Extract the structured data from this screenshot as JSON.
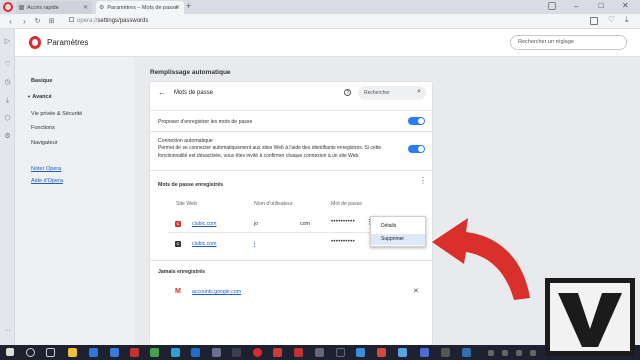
{
  "browser": {
    "tabs": [
      {
        "label": "Accès rapide",
        "active": false
      },
      {
        "label": "Paramètres – Mots de passe",
        "active": true
      }
    ],
    "address": {
      "prefix": "opera://",
      "path": "settings/passwords"
    }
  },
  "header": {
    "title": "Paramètres",
    "search_placeholder": "Rechercher un réglage"
  },
  "nav": {
    "items": [
      {
        "label": "Basique"
      },
      {
        "label": "Avancé"
      },
      {
        "label": "Vie privée & Sécurité"
      },
      {
        "label": "Fonctions"
      },
      {
        "label": "Navigateur"
      }
    ],
    "links": [
      {
        "label": "Noter Opera"
      },
      {
        "label": "Aide d'Opera"
      }
    ]
  },
  "section": {
    "title": "Remplissage automatique"
  },
  "passwords": {
    "title": "Mots de passe",
    "search_placeholder": "Rechercher",
    "offer_save_label": "Proposer d'enregistrer les mots de passe",
    "auto_signin": {
      "title": "Connexion automatique",
      "desc": "Permet de se connecter automatiquement aux sites Web à l'aide des identifiants enregistrés. Si cette fonctionnalité est désactivée, vous êtes invité à confirmer chaque connexion à un site Web."
    },
    "saved_title": "Mots de passe enregistrés",
    "columns": [
      "Site Web",
      "Nom d'utilisateur",
      "Mot de passe"
    ],
    "rows": [
      {
        "site": "clubic.com",
        "user_start": "jo",
        "user_end": "com",
        "password": "••••••••••"
      },
      {
        "site": "clubic.com",
        "user_start": "i",
        "user_end": "",
        "password": "••••••••••"
      }
    ],
    "never_title": "Jamais enregistrés",
    "never_sites": [
      {
        "site": "accounts.google.com"
      }
    ]
  },
  "context_menu": {
    "items": [
      {
        "label": "Détails"
      },
      {
        "label": "Supprimer"
      }
    ]
  },
  "colors": {
    "accent": "#2d7cf6",
    "opera_red": "#e0282d",
    "arrow": "#d9302b",
    "taskbar": "#1e2230"
  }
}
